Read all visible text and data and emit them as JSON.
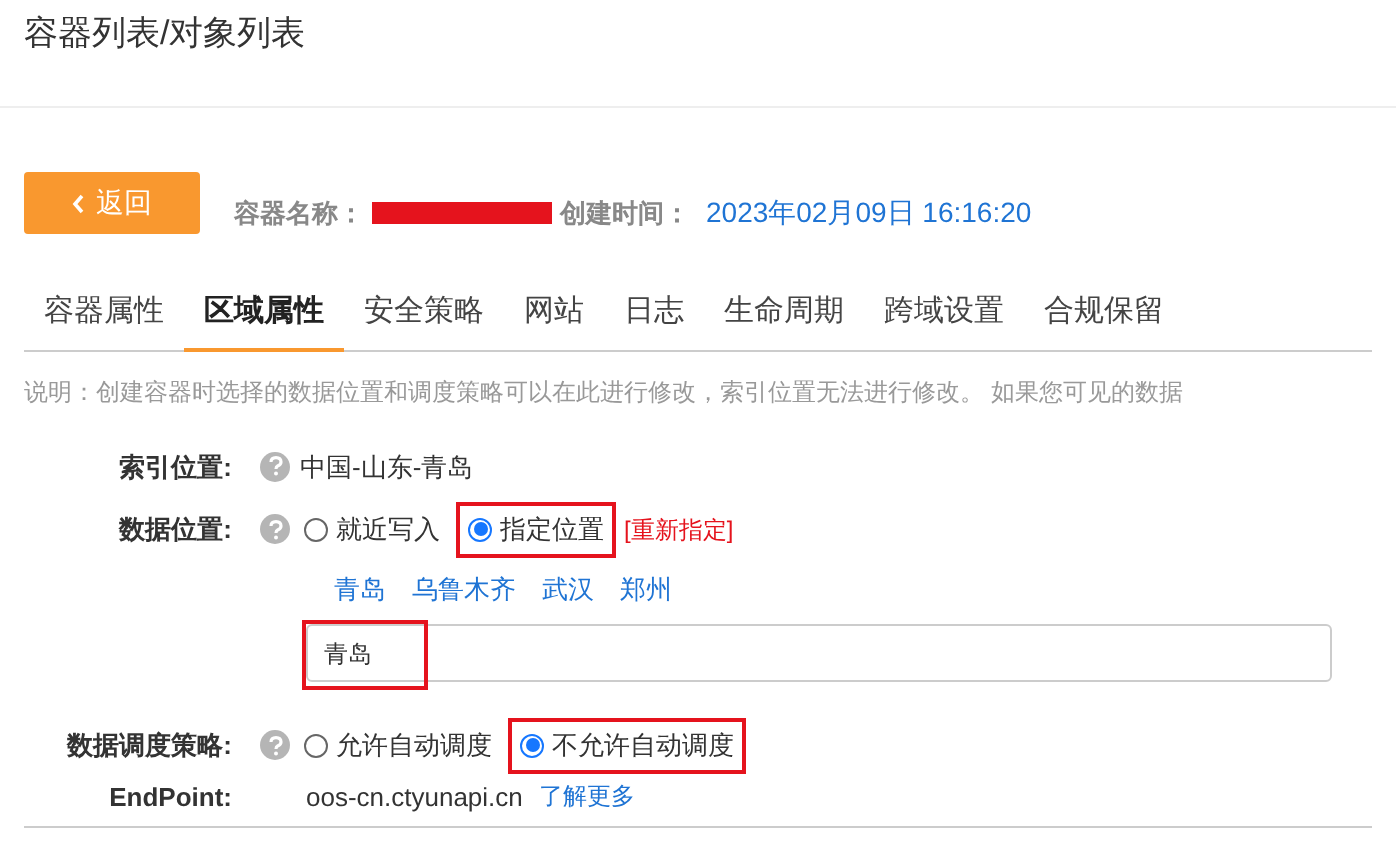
{
  "page_title": "容器列表/对象列表",
  "back_button": {
    "label": "返回"
  },
  "container_name": {
    "label": "容器名称：",
    "redacted": true
  },
  "created": {
    "label": "创建时间：",
    "value": "2023年02月09日 16:16:20"
  },
  "tabs": [
    {
      "label": "容器属性",
      "selected": false
    },
    {
      "label": "区域属性",
      "selected": true
    },
    {
      "label": "安全策略",
      "selected": false
    },
    {
      "label": "网站",
      "selected": false
    },
    {
      "label": "日志",
      "selected": false
    },
    {
      "label": "生命周期",
      "selected": false
    },
    {
      "label": "跨域设置",
      "selected": false
    },
    {
      "label": "合规保留",
      "selected": false
    }
  ],
  "description": "说明：创建容器时选择的数据位置和调度策略可以在此进行修改，索引位置无法进行修改。 如果您可见的数据",
  "index_location": {
    "label": "索引位置:",
    "value": "中国-山东-青岛"
  },
  "data_location": {
    "label": "数据位置:",
    "options": [
      {
        "label": "就近写入",
        "selected": false,
        "highlighted": false
      },
      {
        "label": "指定位置",
        "selected": true,
        "highlighted": true
      }
    ],
    "reassign": "[重新指定]",
    "regions": [
      "青岛",
      "乌鲁木齐",
      "武汉",
      "郑州"
    ],
    "field": {
      "value": "青岛",
      "highlighted": true
    }
  },
  "scheduling": {
    "label": "数据调度策略:",
    "options": [
      {
        "label": "允许自动调度",
        "selected": false,
        "highlighted": false
      },
      {
        "label": "不允许自动调度",
        "selected": true,
        "highlighted": true
      }
    ]
  },
  "endpoint": {
    "label": "EndPoint:",
    "value": "oos-cn.ctyunapi.cn",
    "link": "了解更多"
  }
}
